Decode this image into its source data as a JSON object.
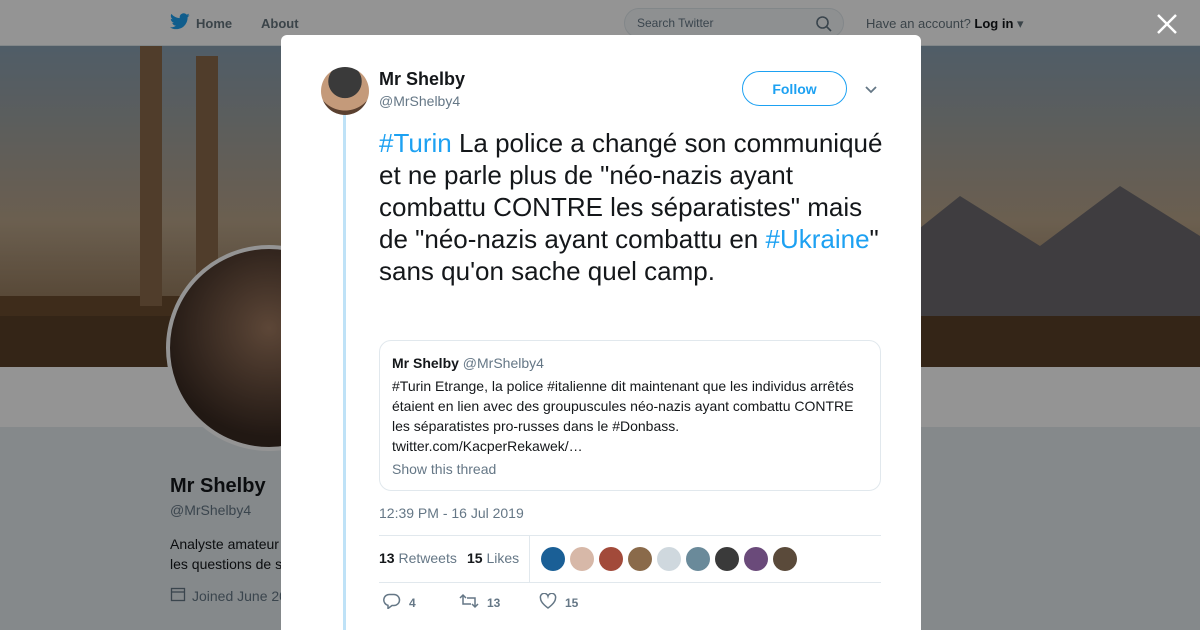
{
  "nav": {
    "home_label": "Home",
    "about_label": "About",
    "search_placeholder": "Search Twitter",
    "account_prompt": "Have an account?",
    "login_label": "Log in"
  },
  "background_profile": {
    "name": "Mr Shelby",
    "handle": "@MrShelby4",
    "bio_line1": "Analyste amateur",
    "bio_line2": "les questions de s",
    "joined": "Joined June 20"
  },
  "tweet": {
    "author_name": "Mr Shelby",
    "author_handle": "@MrShelby4",
    "follow_label": "Follow",
    "text": {
      "hashtag1": "#Turin",
      "part1": " La police a changé son communiqué et ne parle plus de \"néo-nazis ayant combattu CONTRE les séparatistes\" mais de \"néo-nazis ayant combattu en ",
      "hashtag2": "#Ukraine",
      "part2": "\" sans qu'on sache quel camp."
    },
    "quote": {
      "name": "Mr Shelby",
      "handle": "@MrShelby4",
      "text": "#Turin Etrange, la police #italienne dit maintenant que les individus arrêtés étaient en lien avec des groupuscules néo-nazis ayant combattu CONTRE les séparatistes pro-russes dans le #Donbass. twitter.com/KacperRekawek/…",
      "show_thread": "Show this thread"
    },
    "timestamp": "12:39 PM - 16 Jul 2019",
    "retweets_count": "13",
    "retweets_label": "Retweets",
    "likes_count": "15",
    "likes_label": "Likes",
    "liker_colors": [
      "#1a5f96",
      "#d7b8a8",
      "#a24a3a",
      "#8a6a4a",
      "#cfd8de",
      "#6a8a9a",
      "#3a3a3a",
      "#6a4a7a",
      "#5a4a3a"
    ],
    "actions": {
      "replies": "4",
      "retweets": "13",
      "likes": "15"
    }
  }
}
